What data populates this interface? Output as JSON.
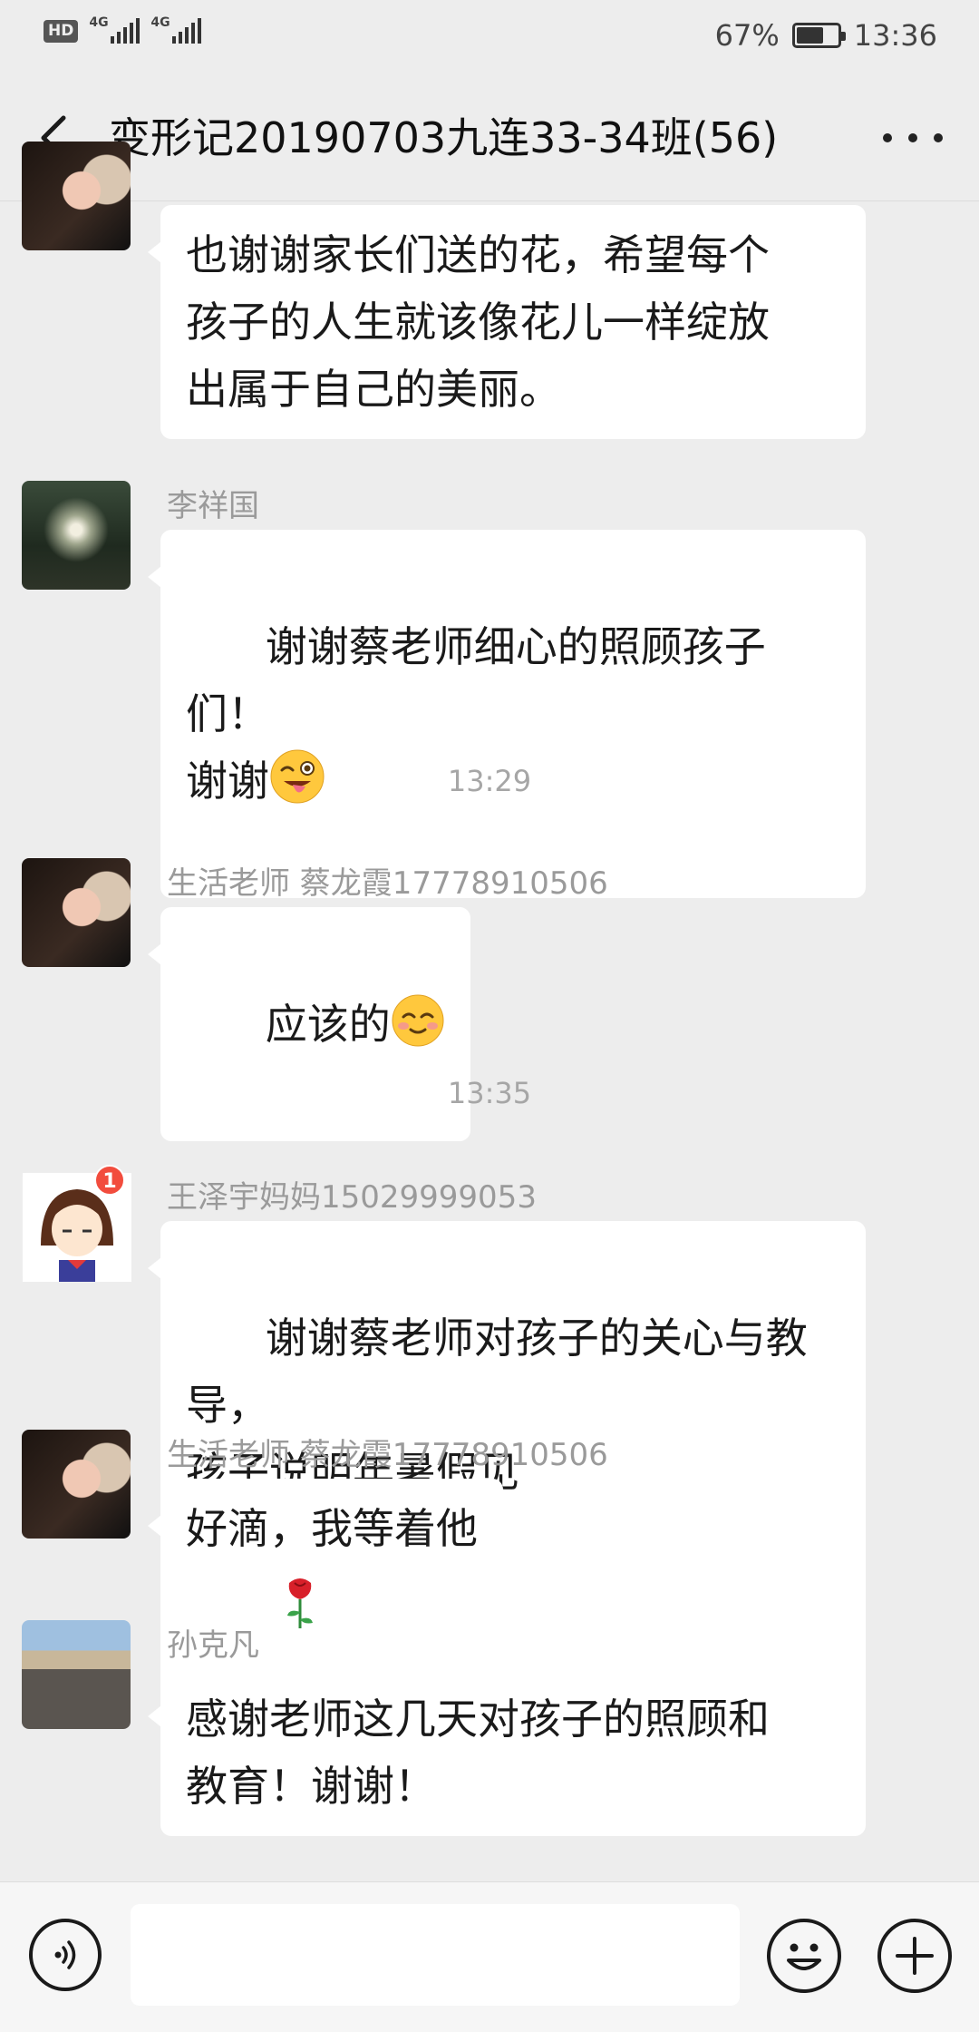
{
  "status_bar": {
    "hd_label": "HD",
    "network_1": "4G",
    "network_2": "4G",
    "battery_percent": "67%",
    "battery_level": 0.67,
    "time": "13:36"
  },
  "header": {
    "title": "变形记20190703九连33-34班(56)",
    "back_icon": "chevron-left-icon",
    "more_icon": "more-dots-icon"
  },
  "messages": [
    {
      "sender": "",
      "avatar_icon": "girl-photo-avatar",
      "text": "也谢谢家长们送的花，希望每个\n孩子的人生就该像花儿一样绽放\n出属于自己的美丽。"
    },
    {
      "sender": "李祥国",
      "avatar_icon": "forest-photo-avatar",
      "text": "谢谢蔡老师细心的照顾孩子们！\n谢谢",
      "emoji": "wink-tongue-emoji"
    },
    {
      "sender": "生活老师 蔡龙霞17778910506",
      "avatar_icon": "girl-photo-avatar",
      "text": "应该的",
      "emoji": "smile-blush-emoji"
    },
    {
      "sender": "王泽宇妈妈15029999053",
      "avatar_icon": "cartoon-girl-avatar",
      "unread_badge": "1",
      "text": "谢谢蔡老师对孩子的关心与教导，\n孩子说明年暑假见",
      "emoji": "rose-emoji"
    },
    {
      "sender": "生活老师 蔡龙霞17778910506",
      "avatar_icon": "girl-photo-avatar",
      "text": "好滴，我等着他"
    },
    {
      "sender": "孙克凡",
      "avatar_icon": "crowd-photo-avatar",
      "text": "感谢老师这几天对孩子的照顾和\n教育！谢谢！"
    }
  ],
  "timestamps": [
    "13:29",
    "13:35"
  ],
  "input_bar": {
    "voice_icon": "voice-icon",
    "input_value": "",
    "emoji_icon": "emoji-face-icon",
    "plus_icon": "plus-icon"
  }
}
